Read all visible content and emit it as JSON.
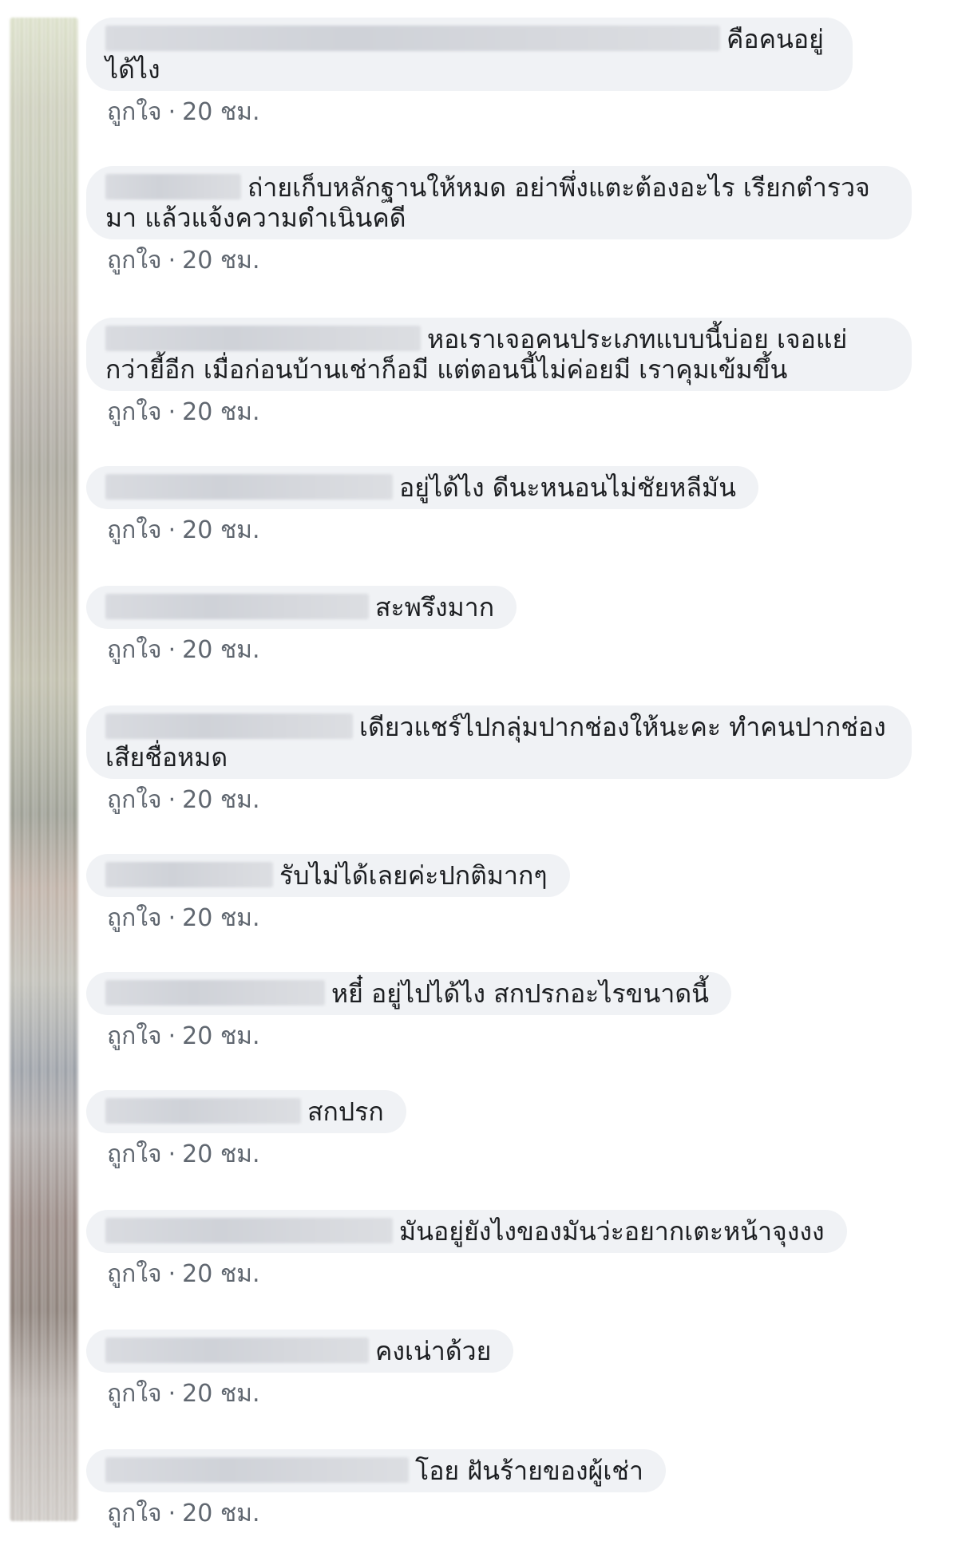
{
  "comments": [
    {
      "text": "คือคนอยู่ได้ไง",
      "like_label": "ถูกใจ",
      "time": "20 ชม."
    },
    {
      "text": "ถ่ายเก็บหลักฐานให้หมด อย่าพึ่งแตะต้องอะไร เรียกตำรวจมา แล้วแจ้งความดำเนินคดี",
      "like_label": "ถูกใจ",
      "time": "20 ชม."
    },
    {
      "text": "หอเราเจอคนประเภทแบบนี้บ่อย เจอแย่กว่ายี้อีก เมื่อก่อนบ้านเช่าก็อมี แต่ตอนนี้ไม่ค่อยมี เราคุมเข้มขึ้น",
      "like_label": "ถูกใจ",
      "time": "20 ชม."
    },
    {
      "text": "อยู่ได้ไง ดีนะหนอนไม่ชัยหลีมัน",
      "like_label": "ถูกใจ",
      "time": "20 ชม."
    },
    {
      "text": "สะพรึงมาก",
      "like_label": "ถูกใจ",
      "time": "20 ชม."
    },
    {
      "text": "เดียวแชร์ไปกลุ่มปากช่องให้นะคะ ทำคนปากช่องเสียชื่อหมด",
      "like_label": "ถูกใจ",
      "time": "20 ชม."
    },
    {
      "text": "รับไม่ได้เลยค่ะปกติมากๆ",
      "like_label": "ถูกใจ",
      "time": "20 ชม."
    },
    {
      "text": "หยี๋ อยู่ไปได้ไง สกปรกอะไรขนาดนี้",
      "like_label": "ถูกใจ",
      "time": "20 ชม."
    },
    {
      "text": "สกปรก",
      "like_label": "ถูกใจ",
      "time": "20 ชม."
    },
    {
      "text": "มันอยู่ยังไงของมันว่ะอยากเตะหน้าจุงงง",
      "like_label": "ถูกใจ",
      "time": "20 ชม."
    },
    {
      "text": "คงเน่าด้วย",
      "like_label": "ถูกใจ",
      "time": "20 ชม."
    },
    {
      "text": "โอย ฝันร้ายของผู้เช่า",
      "like_label": "ถูกใจ",
      "time": "20 ชม."
    }
  ]
}
